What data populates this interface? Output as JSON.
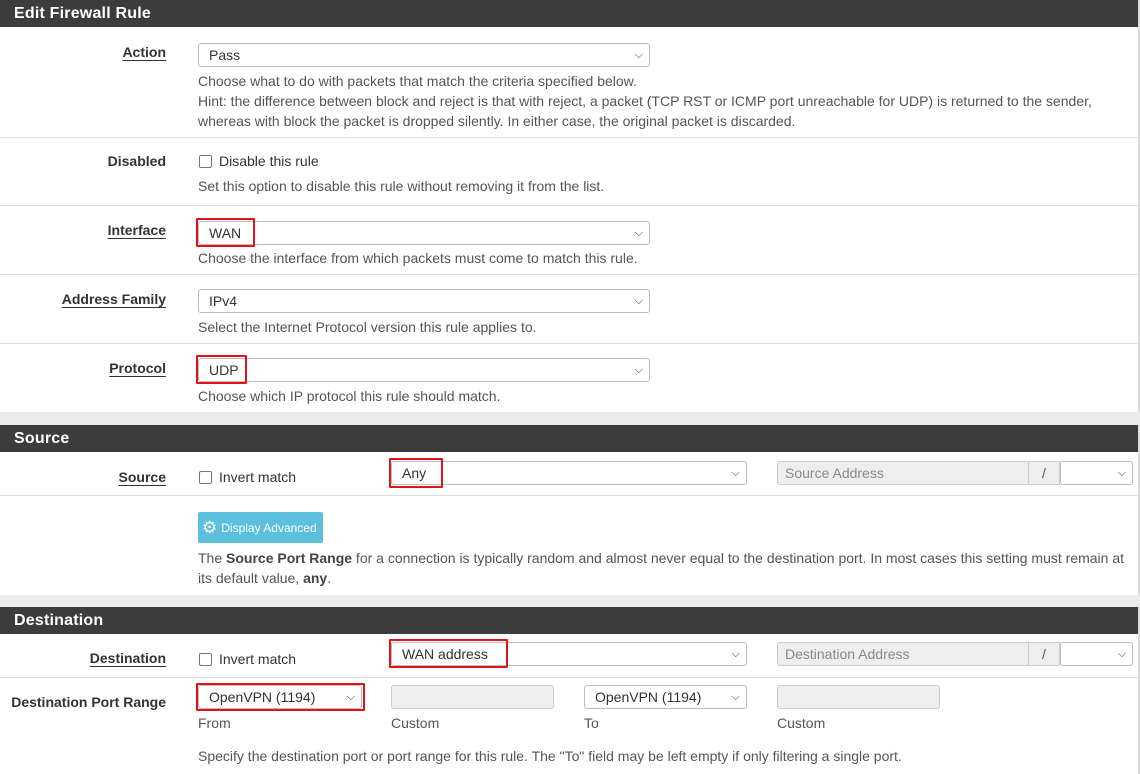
{
  "edit_panel": {
    "title": "Edit Firewall Rule",
    "action": {
      "label": "Action",
      "value": "Pass",
      "help1": "Choose what to do with packets that match the criteria specified below.",
      "help2": "Hint: the difference between block and reject is that with reject, a packet (TCP RST or ICMP port unreachable for UDP) is returned to the sender,",
      "help3": "whereas with block the packet is dropped silently. In either case, the original packet is discarded."
    },
    "disabled": {
      "label": "Disabled",
      "checkbox_label": "Disable this rule",
      "help": "Set this option to disable this rule without removing it from the list."
    },
    "interface": {
      "label": "Interface",
      "value": "WAN",
      "help": "Choose the interface from which packets must come to match this rule."
    },
    "address_family": {
      "label": "Address Family",
      "value": "IPv4",
      "help": "Select the Internet Protocol version this rule applies to."
    },
    "protocol": {
      "label": "Protocol",
      "value": "UDP",
      "help": "Choose which IP protocol this rule should match."
    }
  },
  "source_panel": {
    "title": "Source",
    "label": "Source",
    "invert_label": "Invert match",
    "type_value": "Any",
    "address_placeholder": "Source Address",
    "slash": "/",
    "advanced_button": "Display Advanced",
    "help_pre": "The ",
    "help_bold": "Source Port Range",
    "help_post": " for a connection is typically random and almost never equal to the destination port. In most cases this setting must remain at",
    "help2_pre": "its default value, ",
    "help2_bold": "any",
    "help2_post": "."
  },
  "dest_panel": {
    "title": "Destination",
    "label": "Destination",
    "invert_label": "Invert match",
    "type_value": "WAN address",
    "address_placeholder": "Destination Address",
    "slash": "/",
    "port_range_label": "Destination Port Range",
    "from_value": "OpenVPN (1194)",
    "to_value": "OpenVPN (1194)",
    "from_caption": "From",
    "custom_caption": "Custom",
    "to_caption": "To",
    "help": "Specify the destination port or port range for this rule. The \"To\" field may be left empty if only filtering a single port."
  },
  "colors": {
    "header_bg": "#3c3c3c",
    "highlight": "#e0131a",
    "info_button": "#5bc0de"
  },
  "icons": {
    "dropdown": "chevron-down-icon",
    "gear": "gear-icon"
  }
}
